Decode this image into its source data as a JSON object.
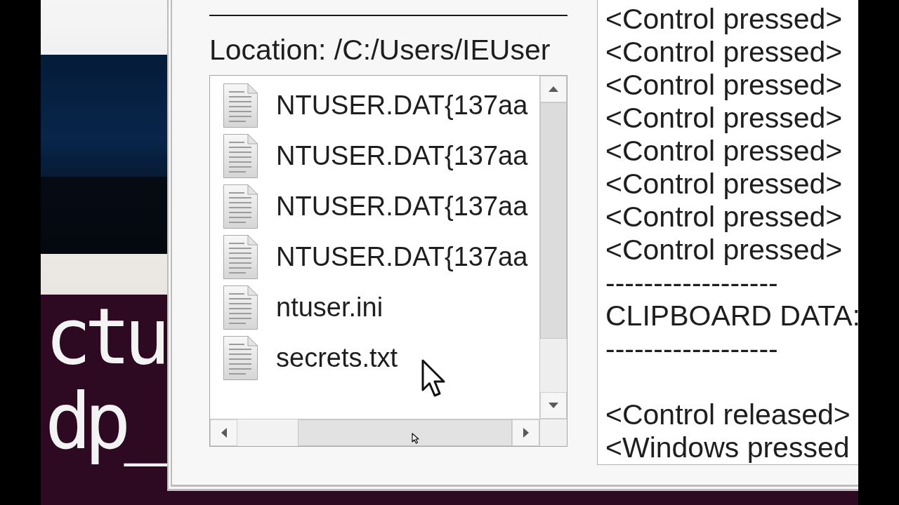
{
  "terminal": {
    "lines": [
      "ctu",
      "dp_"
    ]
  },
  "file_browser": {
    "location": "Location: /C:/Users/IEUser",
    "files": [
      "NTUSER.DAT{137aa",
      "NTUSER.DAT{137aa",
      "NTUSER.DAT{137aa",
      "NTUSER.DAT{137aa",
      "ntuser.ini",
      "secrets.txt"
    ]
  },
  "log": {
    "blocks": [
      {
        "lines": [
          "<Control pressed>",
          "<Control pressed>",
          "<Control pressed>",
          "<Control pressed>",
          "<Control pressed>",
          "<Control pressed>",
          "<Control pressed>",
          "<Control pressed>",
          "------------------",
          "CLIPBOARD DATA:",
          "------------------"
        ]
      },
      {
        "lines": [
          "<Control released>",
          "<Windows pressed"
        ]
      }
    ]
  }
}
